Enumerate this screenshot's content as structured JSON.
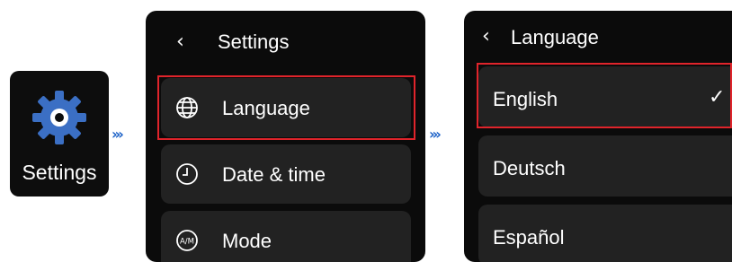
{
  "app_tile": {
    "label": "Settings",
    "icon": "gear-icon"
  },
  "flow_arrow": "›››",
  "settings_screen": {
    "title": "Settings",
    "back_glyph": "‹",
    "items": [
      {
        "label": "Language",
        "icon": "globe-icon"
      },
      {
        "label": "Date & time",
        "icon": "clock-icon"
      },
      {
        "label": "Mode",
        "icon": "am-pm-icon"
      }
    ]
  },
  "language_screen": {
    "title": "Language",
    "back_glyph": "‹",
    "check_glyph": "✓",
    "items": [
      {
        "label": "English",
        "selected": true
      },
      {
        "label": "Deutsch",
        "selected": false
      },
      {
        "label": "Español",
        "selected": false
      }
    ]
  },
  "colors": {
    "highlight": "#e0242b",
    "arrow": "#1e63c8",
    "gear": "#3b6fc4",
    "row_bg": "#222222"
  }
}
